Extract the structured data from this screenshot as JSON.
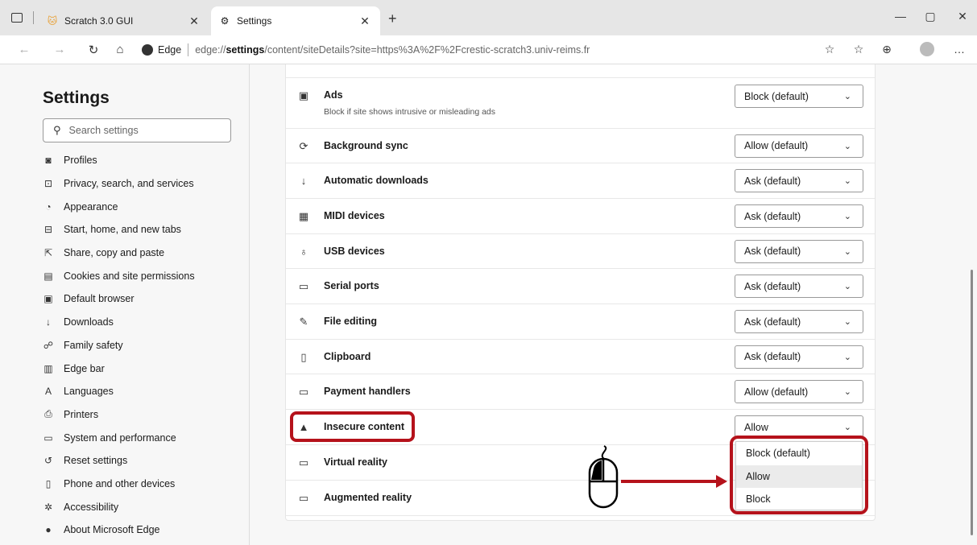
{
  "tabs": [
    {
      "label": "Scratch 3.0 GUI",
      "favicon": "scratch-cat-icon"
    },
    {
      "label": "Settings",
      "favicon": "gear-icon"
    }
  ],
  "address": {
    "site_name": "Edge",
    "protocol": "edge://",
    "host": "settings",
    "path": "/content/siteDetails?site=https%3A%2F%2Fcrestic-scratch3.univ-reims.fr"
  },
  "sidebar": {
    "title": "Settings",
    "search_placeholder": "Search settings",
    "items": [
      {
        "label": "Profiles",
        "icon": "profile-icon",
        "glyph": "◙"
      },
      {
        "label": "Privacy, search, and services",
        "icon": "lock-icon",
        "glyph": "⊡"
      },
      {
        "label": "Appearance",
        "icon": "palette-icon",
        "glyph": "◔"
      },
      {
        "label": "Start, home, and new tabs",
        "icon": "home-tabs-icon",
        "glyph": "⊟"
      },
      {
        "label": "Share, copy and paste",
        "icon": "share-icon",
        "glyph": "⇱"
      },
      {
        "label": "Cookies and site permissions",
        "icon": "cookies-icon",
        "glyph": "▤"
      },
      {
        "label": "Default browser",
        "icon": "default-browser-icon",
        "glyph": "▣"
      },
      {
        "label": "Downloads",
        "icon": "download-icon",
        "glyph": "↓"
      },
      {
        "label": "Family safety",
        "icon": "family-icon",
        "glyph": "☍"
      },
      {
        "label": "Edge bar",
        "icon": "edge-bar-icon",
        "glyph": "▥"
      },
      {
        "label": "Languages",
        "icon": "languages-icon",
        "glyph": "A"
      },
      {
        "label": "Printers",
        "icon": "printer-icon",
        "glyph": "⎙"
      },
      {
        "label": "System and performance",
        "icon": "system-icon",
        "glyph": "▭"
      },
      {
        "label": "Reset settings",
        "icon": "reset-icon",
        "glyph": "↺"
      },
      {
        "label": "Phone and other devices",
        "icon": "phone-icon",
        "glyph": "▯"
      },
      {
        "label": "Accessibility",
        "icon": "accessibility-icon",
        "glyph": "✲"
      },
      {
        "label": "About Microsoft Edge",
        "icon": "edge-logo-icon",
        "glyph": "●"
      }
    ]
  },
  "permissions": [
    {
      "label": "Ads",
      "sub": "Block if site shows intrusive or misleading ads",
      "value": "Block (default)",
      "icon": "ads-icon",
      "glyph": "▣"
    },
    {
      "label": "Background sync",
      "value": "Allow (default)",
      "icon": "sync-icon",
      "glyph": "⟳"
    },
    {
      "label": "Automatic downloads",
      "value": "Ask (default)",
      "icon": "download-icon",
      "glyph": "↓"
    },
    {
      "label": "MIDI devices",
      "value": "Ask (default)",
      "icon": "midi-icon",
      "glyph": "▦"
    },
    {
      "label": "USB devices",
      "value": "Ask (default)",
      "icon": "usb-icon",
      "glyph": "♁"
    },
    {
      "label": "Serial ports",
      "value": "Ask (default)",
      "icon": "serial-port-icon",
      "glyph": "▭"
    },
    {
      "label": "File editing",
      "value": "Ask (default)",
      "icon": "file-edit-icon",
      "glyph": "✎"
    },
    {
      "label": "Clipboard",
      "value": "Ask (default)",
      "icon": "clipboard-icon",
      "glyph": "▯"
    },
    {
      "label": "Payment handlers",
      "value": "Allow (default)",
      "icon": "payment-icon",
      "glyph": "▭"
    },
    {
      "label": "Insecure content",
      "value": "Allow",
      "icon": "warning-icon",
      "glyph": "▲"
    },
    {
      "label": "Virtual reality",
      "value": "",
      "icon": "vr-headset-icon",
      "glyph": "▭"
    },
    {
      "label": "Augmented reality",
      "value": "",
      "icon": "ar-headset-icon",
      "glyph": "▭"
    }
  ],
  "dropdown": {
    "options": [
      "Block (default)",
      "Allow",
      "Block"
    ],
    "highlighted": "Allow"
  },
  "colors": {
    "highlight": "#b5121b"
  }
}
